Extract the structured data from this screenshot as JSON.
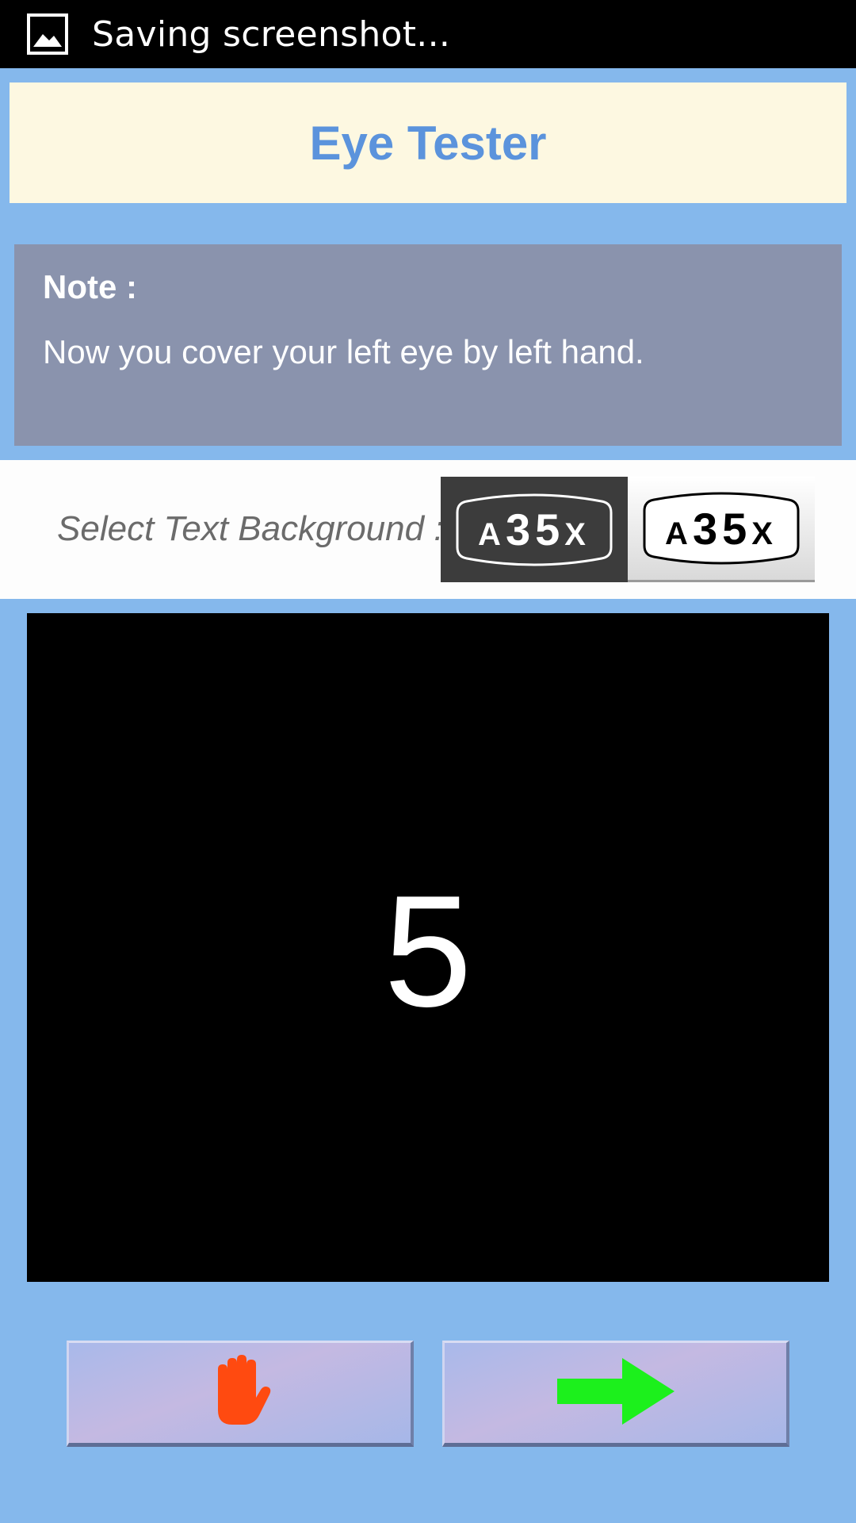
{
  "status_bar": {
    "notification_icon": "image-icon",
    "text": "Saving screenshot..."
  },
  "header": {
    "title": "Eye Tester",
    "title_color": "#5b93dc"
  },
  "note": {
    "label": "Note :",
    "text": "Now you cover your left eye by left hand."
  },
  "background_selector": {
    "label": "Select Text Background :",
    "options": [
      {
        "name": "dark",
        "plate_text": "A 3 5 X",
        "chars": [
          "A",
          "3",
          "5",
          "X"
        ],
        "selected": true
      },
      {
        "name": "light",
        "plate_text": "A 3 5 X",
        "chars": [
          "A",
          "3",
          "5",
          "X"
        ],
        "selected": false
      }
    ]
  },
  "display": {
    "character": "5",
    "background": "#000000",
    "text_color": "#ffffff"
  },
  "buttons": {
    "stop_icon": "hand-stop-icon",
    "stop_icon_color": "#ff4a10",
    "next_icon": "arrow-right-icon",
    "next_icon_color": "#1cf01c"
  },
  "colors": {
    "page_background": "#85b8ec",
    "banner_background": "#fdf8e1",
    "note_background": "#8a93ad"
  }
}
